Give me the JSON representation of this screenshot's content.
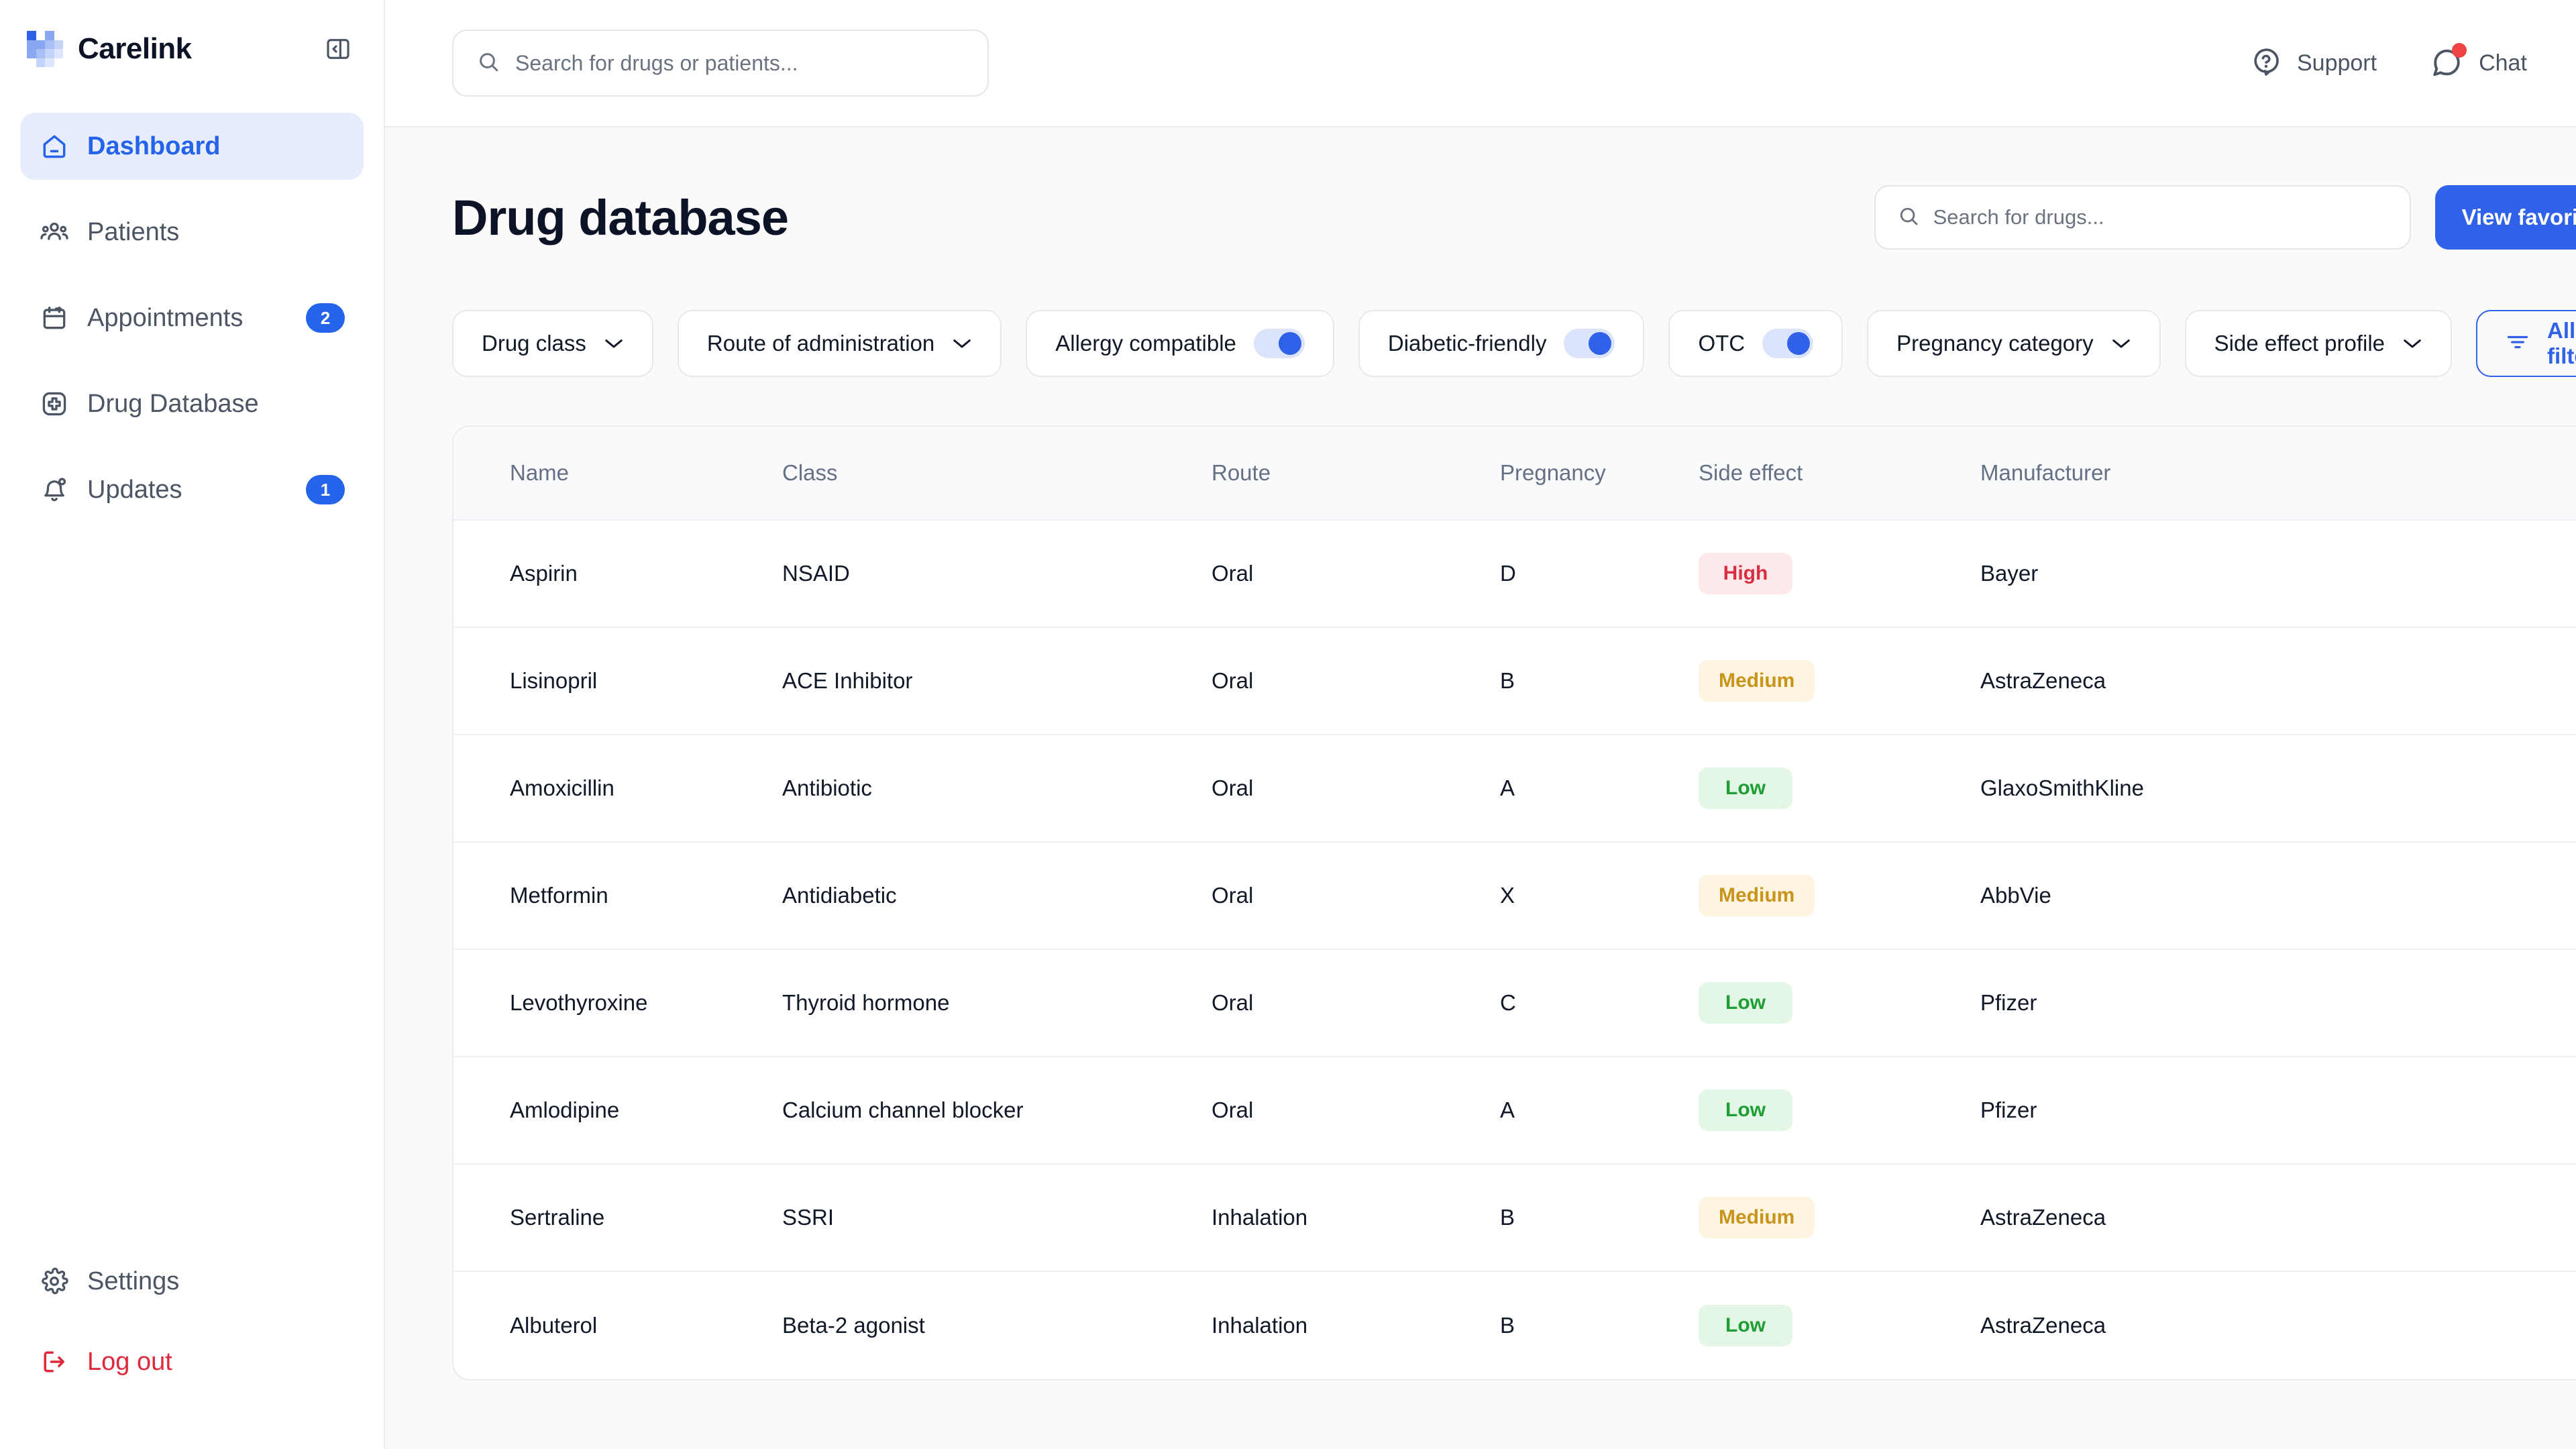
{
  "brand": {
    "name": "Carelink",
    "collapse_icon": "panel-collapse-icon"
  },
  "sidebar": {
    "items": [
      {
        "label": "Dashboard",
        "icon": "home-icon",
        "active": true,
        "badge": ""
      },
      {
        "label": "Patients",
        "icon": "users-icon",
        "active": false,
        "badge": ""
      },
      {
        "label": "Appointments",
        "icon": "calendar-icon",
        "active": false,
        "badge": "2"
      },
      {
        "label": "Drug Database",
        "icon": "medical-cross-icon",
        "active": false,
        "badge": ""
      },
      {
        "label": "Updates",
        "icon": "bell-icon",
        "active": false,
        "badge": "1"
      }
    ],
    "bottom": [
      {
        "label": "Settings",
        "icon": "gear-icon"
      },
      {
        "label": "Log out",
        "icon": "logout-icon"
      }
    ]
  },
  "topbar": {
    "search": {
      "value": "",
      "placeholder": "Search for drugs or patients...",
      "icon": "search-icon"
    },
    "support": {
      "label": "Support",
      "icon": "help-circle-icon"
    },
    "chat": {
      "label": "Chat",
      "icon": "chat-bubble-icon",
      "has_notification": true
    },
    "avatar": {
      "name": "avatar"
    }
  },
  "page": {
    "title": "Drug database",
    "search": {
      "value": "",
      "placeholder": "Search for drugs...",
      "icon": "search-icon"
    },
    "favorites_button": "View favorites"
  },
  "filters": {
    "items": [
      {
        "label": "Drug class",
        "type": "dropdown"
      },
      {
        "label": "Route of administration",
        "type": "dropdown"
      },
      {
        "label": "Allergy compatible",
        "type": "toggle",
        "on": true
      },
      {
        "label": "Diabetic-friendly",
        "type": "toggle",
        "on": true
      },
      {
        "label": "OTC",
        "type": "toggle",
        "on": true
      },
      {
        "label": "Pregnancy category",
        "type": "dropdown"
      },
      {
        "label": "Side effect profile",
        "type": "dropdown"
      }
    ],
    "all_filters": {
      "label": "All filters",
      "icon": "filter-icon"
    }
  },
  "table": {
    "columns": [
      "Name",
      "Class",
      "Route",
      "Pregnancy",
      "Side effect",
      "Manufacturer"
    ],
    "rows": [
      {
        "name": "Aspirin",
        "class": "NSAID",
        "route": "Oral",
        "pregnancy": "D",
        "side_effect": "High",
        "manufacturer": "Bayer"
      },
      {
        "name": "Lisinopril",
        "class": "ACE Inhibitor",
        "route": "Oral",
        "pregnancy": "B",
        "side_effect": "Medium",
        "manufacturer": "AstraZeneca"
      },
      {
        "name": "Amoxicillin",
        "class": "Antibiotic",
        "route": "Oral",
        "pregnancy": "A",
        "side_effect": "Low",
        "manufacturer": "GlaxoSmithKline"
      },
      {
        "name": "Metformin",
        "class": "Antidiabetic",
        "route": "Oral",
        "pregnancy": "X",
        "side_effect": "Medium",
        "manufacturer": "AbbVie"
      },
      {
        "name": "Levothyroxine",
        "class": "Thyroid hormone",
        "route": "Oral",
        "pregnancy": "C",
        "side_effect": "Low",
        "manufacturer": "Pfizer"
      },
      {
        "name": "Amlodipine",
        "class": "Calcium channel blocker",
        "route": "Oral",
        "pregnancy": "A",
        "side_effect": "Low",
        "manufacturer": "Pfizer"
      },
      {
        "name": "Sertraline",
        "class": "SSRI",
        "route": "Inhalation",
        "pregnancy": "B",
        "side_effect": "Medium",
        "manufacturer": "AstraZeneca"
      },
      {
        "name": "Albuterol",
        "class": "Beta-2 agonist",
        "route": "Inhalation",
        "pregnancy": "B",
        "side_effect": "Low",
        "manufacturer": "AstraZeneca"
      }
    ],
    "row_action_icon": "kebab-menu-icon"
  },
  "colors": {
    "accent": "#2f62e8",
    "sidebar_active_bg": "#e8edfd",
    "logout": "#e0283b",
    "high_bg": "#fde8ea",
    "high_fg": "#d92d42",
    "medium_bg": "#fdf4e2",
    "medium_fg": "#c8941a",
    "low_bg": "#e4f6e5",
    "low_fg": "#1e9e34"
  }
}
